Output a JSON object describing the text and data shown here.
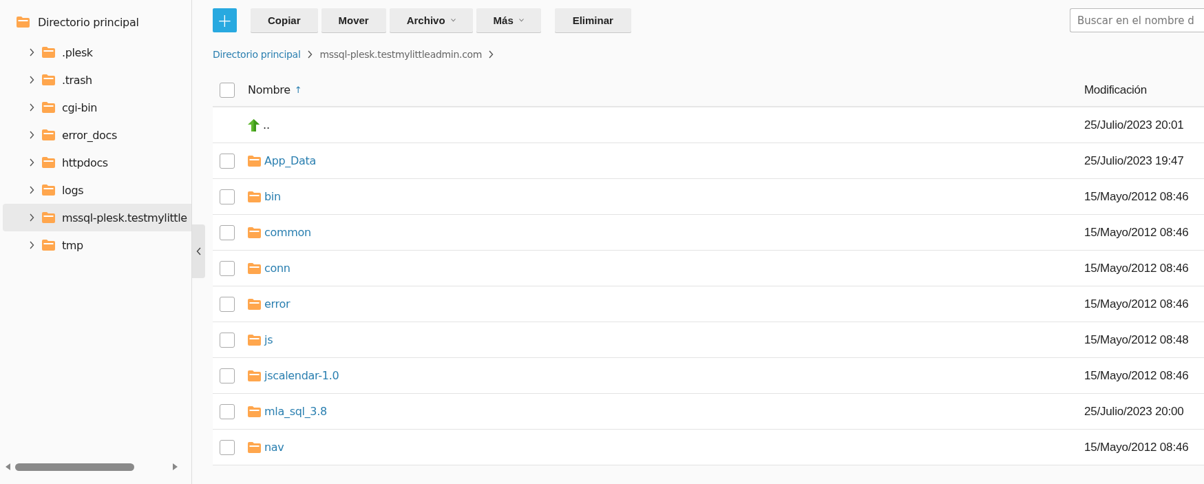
{
  "sidebar": {
    "root": {
      "label": "Directorio principal"
    },
    "items": [
      {
        "label": ".plesk",
        "selected": false,
        "expanded": false
      },
      {
        "label": ".trash",
        "selected": false,
        "expanded": false
      },
      {
        "label": "cgi-bin",
        "selected": false,
        "expanded": false
      },
      {
        "label": "error_docs",
        "selected": false,
        "expanded": false
      },
      {
        "label": "httpdocs",
        "selected": false,
        "expanded": false
      },
      {
        "label": "logs",
        "selected": false,
        "expanded": false
      },
      {
        "label": "mssql-plesk.testmylittle",
        "selected": true,
        "expanded": false
      },
      {
        "label": "tmp",
        "selected": false,
        "expanded": false
      }
    ]
  },
  "toolbar": {
    "add_button": {
      "label": "+"
    },
    "buttons": [
      {
        "label": "Copiar",
        "dropdown": false
      },
      {
        "label": "Mover",
        "dropdown": false
      },
      {
        "label": "Archivo",
        "dropdown": true
      },
      {
        "label": "Más",
        "dropdown": true
      },
      {
        "label": "Eliminar",
        "dropdown": false
      }
    ],
    "search": {
      "placeholder": "Buscar en el nombre d"
    }
  },
  "breadcrumb": [
    {
      "label": "Directorio principal",
      "kind": "link"
    },
    {
      "label": "mssql-plesk.testmylittleadmin.com",
      "kind": "current"
    }
  ],
  "table": {
    "header": {
      "checked": false
    },
    "columns": [
      {
        "label": "Nombre",
        "sort": "↑"
      },
      {
        "label": "Modificación"
      }
    ],
    "rows": [
      {
        "kind": "parent",
        "name": "..",
        "modified": "25/Julio/2023 20:01"
      },
      {
        "kind": "folder",
        "checked": false,
        "name": "App_Data",
        "modified": "25/Julio/2023 19:47"
      },
      {
        "kind": "folder",
        "checked": false,
        "name": "bin",
        "modified": "15/Mayo/2012 08:46"
      },
      {
        "kind": "folder",
        "checked": false,
        "name": "common",
        "modified": "15/Mayo/2012 08:46"
      },
      {
        "kind": "folder",
        "checked": false,
        "name": "conn",
        "modified": "15/Mayo/2012 08:46"
      },
      {
        "kind": "folder",
        "checked": false,
        "name": "error",
        "modified": "15/Mayo/2012 08:46"
      },
      {
        "kind": "folder",
        "checked": false,
        "name": "js",
        "modified": "15/Mayo/2012 08:48"
      },
      {
        "kind": "folder",
        "checked": false,
        "name": "jscalendar-1.0",
        "modified": "15/Mayo/2012 08:46"
      },
      {
        "kind": "folder",
        "checked": false,
        "name": "mla_sql_3.8",
        "modified": "25/Julio/2023 20:00"
      },
      {
        "kind": "folder",
        "checked": false,
        "name": "nav",
        "modified": "15/Mayo/2012 08:46"
      }
    ]
  }
}
